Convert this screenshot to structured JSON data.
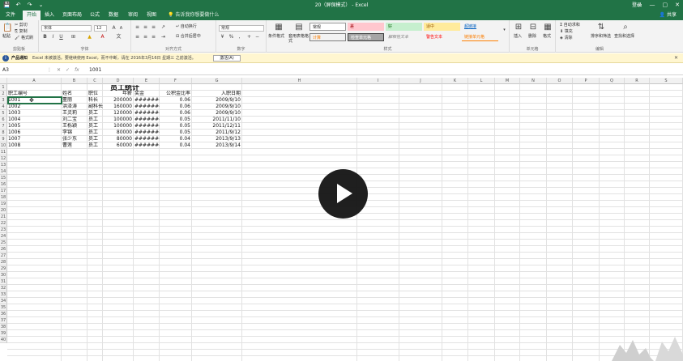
{
  "titlebar": {
    "qat": [
      "💾",
      "↶",
      "↷",
      "⌄"
    ],
    "title": "20（屏保模式） - Excel",
    "login": "登录",
    "win": [
      "▭",
      "—",
      "▢",
      "✕"
    ]
  },
  "tabs": [
    "文件",
    "开始",
    "插入",
    "页面布局",
    "公式",
    "数据",
    "审阅",
    "视图"
  ],
  "active_tab": "开始",
  "tellme": "告诉我你想要做什么",
  "share": "共享",
  "ribbon": {
    "clipboard": {
      "paste": "粘贴",
      "cut": "剪切",
      "copy": "复制",
      "format_painter": "格式刷",
      "label": "剪贴板"
    },
    "font": {
      "name": "宋体",
      "size": "12",
      "label": "字体"
    },
    "alignment": {
      "wrap": "自动换行",
      "merge": "合并后居中",
      "label": "对齐方式"
    },
    "number": {
      "format": "常规",
      "label": "数字"
    },
    "styles": {
      "cond": "条件格式",
      "table": "套用表格格式",
      "cells": [
        "常规",
        "差",
        "好",
        "适中",
        "超链接",
        "计算",
        "检查单元格",
        "解释性文本",
        "警告文本",
        "链接单元格"
      ],
      "label": "样式"
    },
    "cells_group": {
      "insert": "插入",
      "delete": "删除",
      "format": "格式",
      "label": "单元格"
    },
    "editing": {
      "autosum": "自动求和",
      "fill": "填充",
      "clear": "清除",
      "sort": "排序和筛选",
      "find": "查找和选择",
      "label": "编辑"
    }
  },
  "notice": {
    "title": "产品通知",
    "text": "Excel 未被激活。要继续使用 Excel，而不中断，请在 2016年3月16日 星期三 之前激活。",
    "button": "激活(A)",
    "close": "✕"
  },
  "formula": {
    "namebox": "A3",
    "icons": [
      "⋮",
      "✕",
      "✓",
      "fx"
    ],
    "value": "1001"
  },
  "columns": [
    "A",
    "B",
    "C",
    "D",
    "E",
    "F",
    "G",
    "H",
    "I",
    "J",
    "K",
    "L",
    "M",
    "N",
    "O",
    "P",
    "Q",
    "R",
    "S"
  ],
  "sheet": {
    "title": "员工统计",
    "headers": [
      "职工编号",
      "姓名",
      "职位",
      "年薪",
      "奖金",
      "公积金比率",
      "入职日期"
    ],
    "rows": [
      [
        "1001",
        "董丽",
        "科长",
        "200000",
        "########",
        "0.06",
        "2009/9/10"
      ],
      [
        "1002",
        "洪泽涛",
        "副科长",
        "160000",
        "########",
        "0.06",
        "2009/9/10"
      ],
      [
        "1003",
        "王灵莉",
        "员工",
        "120000",
        "########",
        "0.06",
        "2009/9/10"
      ],
      [
        "1004",
        "刘二宝",
        "员工",
        "100000",
        "########",
        "0.05",
        "2011/11/10"
      ],
      [
        "1005",
        "王栎颖",
        "员工",
        "100000",
        "########",
        "0.05",
        "2011/12/11"
      ],
      [
        "1006",
        "李锦",
        "员工",
        "80000",
        "########",
        "0.05",
        "2011/9/12"
      ],
      [
        "1007",
        "张少东",
        "员工",
        "80000",
        "########",
        "0.04",
        "2013/9/13"
      ],
      [
        "1008",
        "曹莲",
        "员工",
        "60000",
        "########",
        "0.04",
        "2013/9/14"
      ]
    ],
    "row_numbers": [
      "1",
      "2",
      "3",
      "4",
      "5",
      "6",
      "7",
      "8",
      "9",
      "10",
      "11",
      "12",
      "13",
      "14",
      "15",
      "16",
      "17",
      "18",
      "19",
      "20",
      "21",
      "22",
      "23",
      "24",
      "25",
      "26",
      "27",
      "28",
      "29",
      "30",
      "31",
      "32",
      "33",
      "34",
      "35",
      "36",
      "37",
      "38",
      "39",
      "40"
    ]
  },
  "icons": {
    "play": "play-icon",
    "info": "info-icon"
  }
}
